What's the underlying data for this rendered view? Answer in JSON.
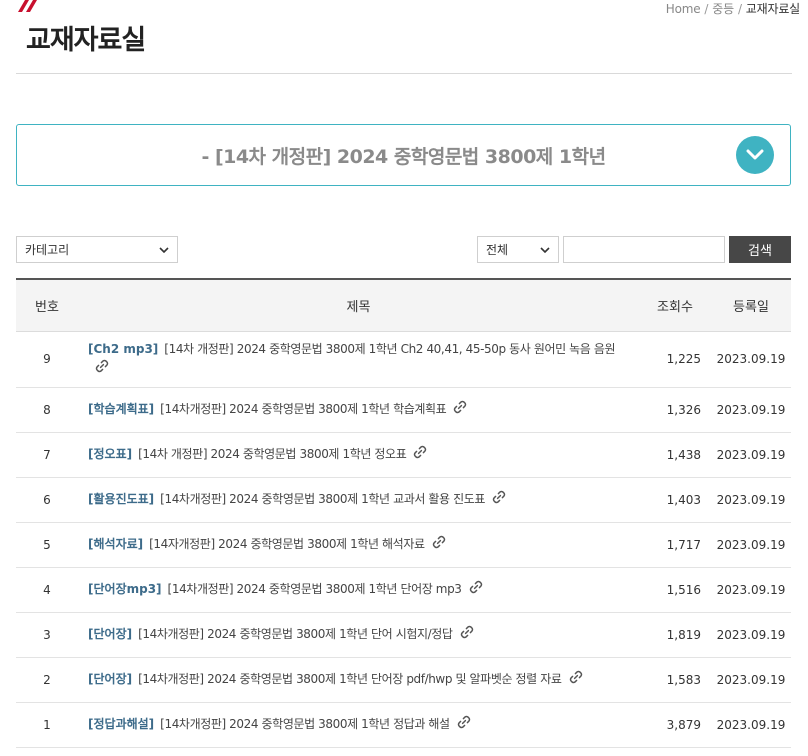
{
  "breadcrumb": {
    "home": "Home",
    "middle": "중등",
    "current": "교재자료실"
  },
  "page": {
    "title": "교재자료실"
  },
  "book": {
    "selected": "- [14차 개정판] 2024 중학영문법 3800제 1학년"
  },
  "filters": {
    "category_value": "카테고리",
    "scope_value": "전체",
    "search_value": "",
    "search_button": "검색"
  },
  "table": {
    "headers": {
      "no": "번호",
      "title": "제목",
      "views": "조회수",
      "date": "등록일"
    },
    "rows": [
      {
        "no": "9",
        "category": "[Ch2 mp3]",
        "title": "[14차 개정판] 2024 중학영문법 3800제 1학년 Ch2 40,41, 45-50p 동사 원어민 녹음 음원",
        "views": "1,225",
        "date": "2023.09.19"
      },
      {
        "no": "8",
        "category": "[학습계획표]",
        "title": "[14차개정판] 2024 중학영문법 3800제 1학년 학습계획표",
        "views": "1,326",
        "date": "2023.09.19"
      },
      {
        "no": "7",
        "category": "[정오표]",
        "title": "[14차 개정판] 2024 중학영문법 3800제 1학년 정오표",
        "views": "1,438",
        "date": "2023.09.19"
      },
      {
        "no": "6",
        "category": "[활용진도표]",
        "title": "[14차개정판] 2024 중학영문법 3800제 1학년 교과서 활용 진도표",
        "views": "1,403",
        "date": "2023.09.19"
      },
      {
        "no": "5",
        "category": "[해석자료]",
        "title": "[14자개정판] 2024 중학영문법 3800제 1학년 해석자료",
        "views": "1,717",
        "date": "2023.09.19"
      },
      {
        "no": "4",
        "category": "[단어장mp3]",
        "title": "[14차개정판] 2024 중학영문법 3800제 1학년 단어장 mp3",
        "views": "1,516",
        "date": "2023.09.19"
      },
      {
        "no": "3",
        "category": "[단어장]",
        "title": "[14차개정판] 2024 중학영문법 3800제 1학년 단어 시험지/정답",
        "views": "1,819",
        "date": "2023.09.19"
      },
      {
        "no": "2",
        "category": "[단어장]",
        "title": "[14차개정판] 2024 중학영문법 3800제 1학년 단어장 pdf/hwp 및 알파벳순 정렬 자료",
        "views": "1,583",
        "date": "2023.09.19"
      },
      {
        "no": "1",
        "category": "[정답과해설]",
        "title": "[14차개정판] 2024 중학영문법 3800제 1학년 정답과 해설",
        "views": "3,879",
        "date": "2023.09.19"
      }
    ]
  },
  "colors": {
    "accent": "#3fb3c2",
    "category_text": "#3d6b8a",
    "search_button_bg": "#474747",
    "logo": "#c8102e"
  }
}
